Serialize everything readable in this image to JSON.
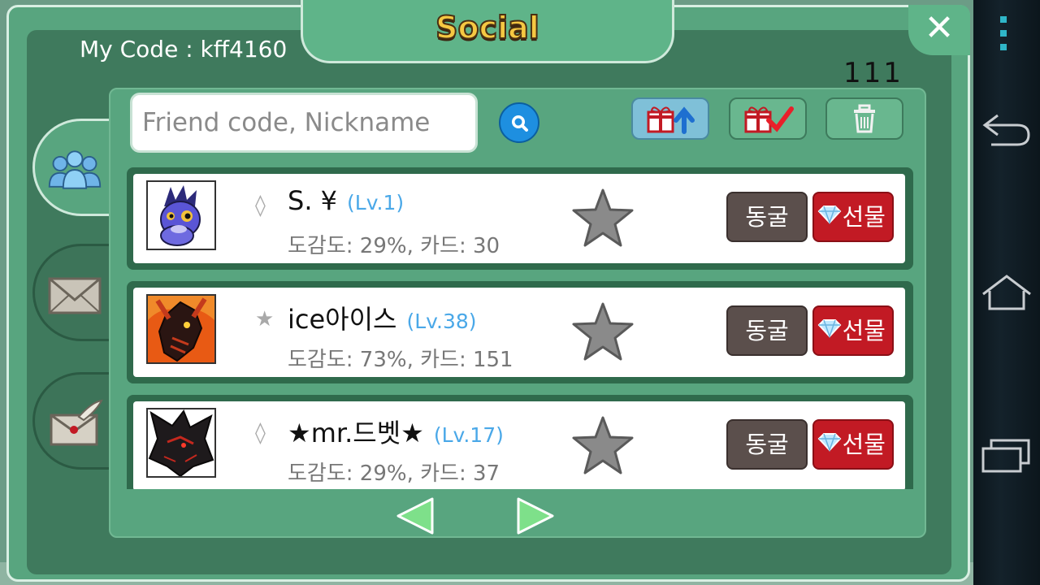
{
  "header": {
    "title": "Social",
    "my_code": "My Code : kff4160",
    "counter": "111",
    "close_icon": "close-icon"
  },
  "side_tabs": [
    {
      "id": "friends",
      "icon": "friends-icon",
      "active": true
    },
    {
      "id": "mail",
      "icon": "mail-icon",
      "active": false
    },
    {
      "id": "invite",
      "icon": "letter-feather-icon",
      "active": false
    }
  ],
  "search": {
    "placeholder": "Friend code, Nickname",
    "value": "",
    "button_icon": "search-icon"
  },
  "toolbar": [
    {
      "id": "gift-send",
      "icon": "gift-upload-icon",
      "selected": true
    },
    {
      "id": "gift-check",
      "icon": "gift-check-icon",
      "selected": false
    },
    {
      "id": "delete",
      "icon": "trash-icon",
      "selected": false
    }
  ],
  "friends": [
    {
      "badge": "◊",
      "name": "S. ¥",
      "level": "(Lv.1)",
      "stats": "도감도: 29%, 카드: 30",
      "cave_label": "동굴",
      "gift_label": "선물",
      "avatar": "blue-dragon"
    },
    {
      "badge": "★",
      "name": "ice아이스",
      "level": "(Lv.38)",
      "stats": "도감도: 73%, 카드: 151",
      "cave_label": "동굴",
      "gift_label": "선물",
      "avatar": "red-dragon"
    },
    {
      "badge": "◊",
      "name": "★mr.드벳★",
      "level": "(Lv.17)",
      "stats": "도감도: 29%, 카드: 37",
      "cave_label": "동굴",
      "gift_label": "선물",
      "avatar": "black-dragon"
    }
  ],
  "pager": {
    "prev_icon": "arrow-left-icon",
    "next_icon": "arrow-right-icon"
  },
  "android": {
    "menu_icon": "overflow-menu-icon",
    "back_icon": "back-icon",
    "home_icon": "home-icon",
    "recents_icon": "recents-icon"
  },
  "colors": {
    "panel": "#58a57f",
    "title_gold": "#f5c842",
    "gift_red": "#c21a24",
    "cave_gray": "#5b4f4c",
    "level_blue": "#4aa8e8"
  }
}
